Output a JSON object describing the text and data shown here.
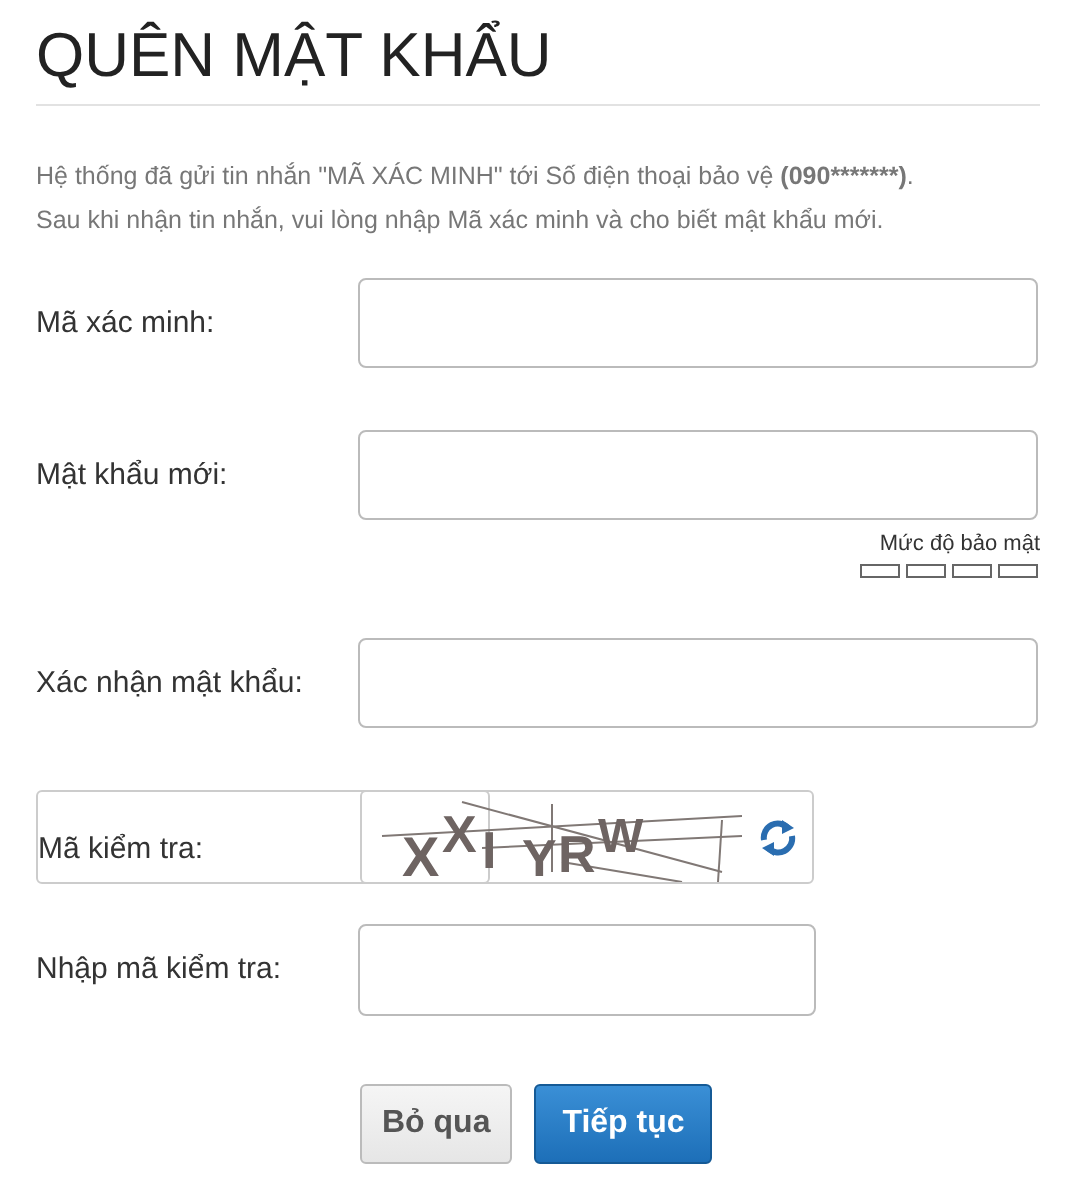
{
  "title": "QUÊN MẬT KHẨU",
  "intro": [
    {
      "text": "Hệ thống đã gửi tin nhắn \"MÃ XÁC MINH\" tới Số điện thoại bảo vệ ",
      "bold": "(090*******)",
      "end": "."
    },
    {
      "text": "Sau khi nhận tin nhắn, vui lòng nhập Mã xác minh và cho biết mật khẩu mới."
    }
  ],
  "fields": [
    {
      "kind": "input",
      "label": "Mã xác minh:"
    },
    {
      "kind": "password",
      "label": "Mật khẩu mới:",
      "strength_label": "Mức độ bảo mật"
    },
    {
      "kind": "input",
      "label": "Xác nhận mật khẩu:"
    },
    {
      "kind": "captcha",
      "label": "Mã kiểm tra:",
      "captcha": [
        "X",
        "X",
        "I",
        "Y",
        "R",
        "W"
      ]
    },
    {
      "kind": "short",
      "label": "Nhập mã kiểm tra:"
    }
  ],
  "buttons": [
    {
      "label": "Bỏ qua",
      "kind": "secondary"
    },
    {
      "label": "Tiếp tục",
      "kind": "primary"
    }
  ]
}
